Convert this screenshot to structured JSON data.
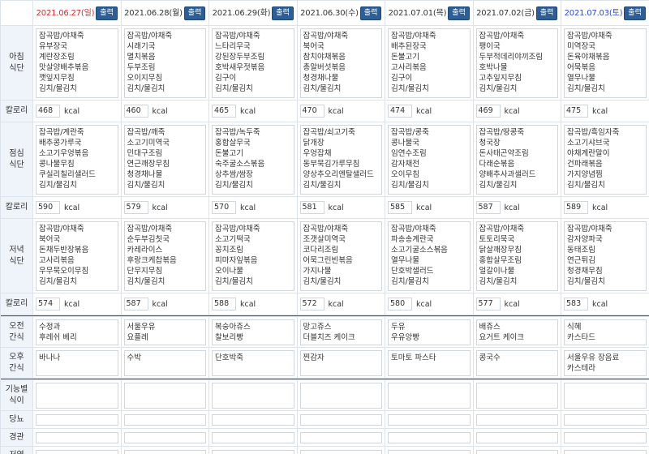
{
  "days": [
    {
      "date": "2021.06.27(일)",
      "kind": "sun"
    },
    {
      "date": "2021.06.28(월)",
      "kind": "wk"
    },
    {
      "date": "2021.06.29(화)",
      "kind": "wk"
    },
    {
      "date": "2021.06.30(수)",
      "kind": "wk"
    },
    {
      "date": "2021.07.01(목)",
      "kind": "wk"
    },
    {
      "date": "2021.07.02(금)",
      "kind": "wk"
    },
    {
      "date": "2021.07.03(토)",
      "kind": "sat"
    }
  ],
  "print_label": "출력",
  "labels": {
    "breakfast": "아침 식단",
    "lunch": "점심 식단",
    "dinner": "저녁 식단",
    "calorie": "칼로리",
    "am_snack": "오전 간식",
    "pm_snack": "오후 간식",
    "special": "기능별 식이",
    "diabetes": "당뇨",
    "tube": "경관",
    "pureed": "저염"
  },
  "kcal_unit": "kcal",
  "breakfast": [
    [
      "잡곡밥/야채죽",
      "유부장국",
      "계란장조림",
      "맛살양배추볶음",
      "깻잎지무침",
      "김치/물김치"
    ],
    [
      "잡곡밥/야채죽",
      "시래기국",
      "멸치볶음",
      "두부조림",
      "오이지무침",
      "김치/물김치"
    ],
    [
      "잡곡밥/야채죽",
      "느타리무국",
      "강된장두부조림",
      "호박새우젓볶음",
      "김구이",
      "김치/물김치"
    ],
    [
      "잡곡밥/야채죽",
      "북어국",
      "참치야채볶음",
      "총알버섯볶음",
      "청경채나물",
      "김치/물김치"
    ],
    [
      "잡곡밥/야채죽",
      "배추된장국",
      "돈불고기",
      "고사리볶음",
      "김구이",
      "김치/물김치"
    ],
    [
      "잡곡밥/야채죽",
      "팽이국",
      "두부적데리야끼조림",
      "호박나물",
      "고추잎지무침",
      "김치/물김치"
    ],
    [
      "잡곡밥/야채죽",
      "미역장국",
      "돈육야채볶음",
      "어묵볶음",
      "열무나물",
      "김치/물김치"
    ]
  ],
  "breakfast_kcal": [
    "468",
    "460",
    "465",
    "470",
    "474",
    "469",
    "475"
  ],
  "lunch": [
    [
      "잡곡밥/계란죽",
      "배추콩가루국",
      "소고기우엉볶음",
      "콩나물무침",
      "쿠실리칠리샐러드",
      "김치/물김치"
    ],
    [
      "잡곡밥/깨죽",
      "소고기미역국",
      "민대구조림",
      "연근깨장무침",
      "청경채나물",
      "김치/물김치"
    ],
    [
      "잡곡밥/녹두죽",
      "홍합살무국",
      "돈불고기",
      "숙주굴소스볶음",
      "상추쌈/쌈장",
      "김치/물김치"
    ],
    [
      "잡곡밥/쇠고기죽",
      "닭개장",
      "우엉잡채",
      "동부묵김가루무침",
      "양상추오리엔탈샐러드",
      "김치/물김치"
    ],
    [
      "잡곡밥/콩죽",
      "콩나물국",
      "임연수조림",
      "감자채전",
      "오이무침",
      "김치/물김치"
    ],
    [
      "잡곡밥/땅콩죽",
      "청국장",
      "돈사태곤약조림",
      "다래순볶음",
      "양배추사과샐러드",
      "김치/물김치"
    ],
    [
      "잡곡밥/흑임자죽",
      "소고기샤브국",
      "야채계란말이",
      "건파래볶음",
      "가지양념찜",
      "김치/물김치"
    ]
  ],
  "lunch_kcal": [
    "590",
    "579",
    "570",
    "581",
    "585",
    "587",
    "589"
  ],
  "dinner": [
    [
      "잡곡밥/야채죽",
      "북어국",
      "돈채두반장볶음",
      "고사리볶음",
      "우무묵오이무침",
      "김치/물김치"
    ],
    [
      "잡곡밥/야채죽",
      "순두부김칫국",
      "카레라이스",
      "후랑크케찹볶음",
      "단무지무침",
      "김치/물김치"
    ],
    [
      "잡곡밥/야채죽",
      "소고기떡국",
      "꽁치조림",
      "피마자잎볶음",
      "오이나물",
      "김치/물김치"
    ],
    [
      "잡곡밥/야채죽",
      "조갯살미역국",
      "코다리조림",
      "어묵그린빈볶음",
      "가지나물",
      "김치/물김치"
    ],
    [
      "잡곡밥/야채죽",
      "파송송계란국",
      "소고기굴소스볶음",
      "열무나물",
      "단호박샐러드",
      "김치/물김치"
    ],
    [
      "잡곡밥/야채죽",
      "토토리묵국",
      "닭살깨장무침",
      "홍합살무조림",
      "얼갈이나물",
      "김치/물김치"
    ],
    [
      "잡곡밥/야채죽",
      "감자양파국",
      "동태조림",
      "연근튀김",
      "청경채무침",
      "김치/물김치"
    ]
  ],
  "dinner_kcal": [
    "574",
    "587",
    "588",
    "572",
    "580",
    "577",
    "583"
  ],
  "am_snack": [
    [
      "수정과",
      "후레쉬 베리"
    ],
    [
      "서울우유",
      "요플레"
    ],
    [
      "복숭아쥬스",
      "찰보리빵"
    ],
    [
      "망고쥬스",
      "더블치즈 케이크"
    ],
    [
      "두유",
      "우유앙빵"
    ],
    [
      "배쥬스",
      "요거트 케이크"
    ],
    [
      "식혜",
      "카스타드"
    ]
  ],
  "pm_snack": [
    [
      "바나나"
    ],
    [
      "수박"
    ],
    [
      "단호박죽"
    ],
    [
      "찐감자"
    ],
    [
      "토마토 파스타"
    ],
    [
      "콩국수"
    ],
    [
      "서울우유 장음료",
      "카스테라"
    ]
  ]
}
